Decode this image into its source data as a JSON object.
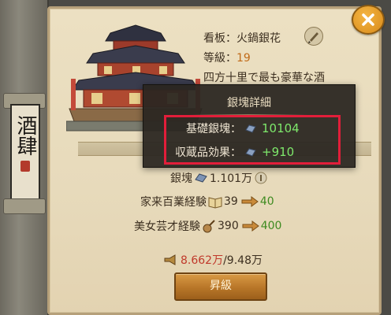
{
  "banner": {
    "char": "酒肆"
  },
  "building": {
    "signboard_label": "看板：",
    "signboard_value": "火鍋銀花",
    "level_label": "等級：",
    "level_value": "19",
    "desc_line1": "四方十里で最も豪華な酒",
    "desc_line2": "■■■■■■■■■■■■",
    "desc_line3": "■■■■■■■■■■■■"
  },
  "tooltip": {
    "title": "銀塊詳細",
    "base_label": "基礎銀塊：",
    "base_value": "10104",
    "collection_label": "収蔵品効果：",
    "collection_value": "+910"
  },
  "stats": {
    "silver_label": "銀塊",
    "silver_value": "1.101万",
    "retainer_label": "家来百業経験",
    "retainer_value": "39",
    "retainer_gain": "40",
    "beauty_label": "美女芸才経験",
    "beauty_value": "390",
    "beauty_gain": "400"
  },
  "resource": {
    "current": "8.662万",
    "max": "/9.48万"
  },
  "upgrade_button": "昇級",
  "colors": {
    "highlight": "#e21e3a",
    "gain": "#7ee86b",
    "accent": "#c06a18"
  },
  "icons": [
    "close-icon",
    "silver-ingot-icon",
    "brush-icon",
    "book-icon",
    "lute-icon",
    "arrow-icon",
    "horn-icon"
  ]
}
